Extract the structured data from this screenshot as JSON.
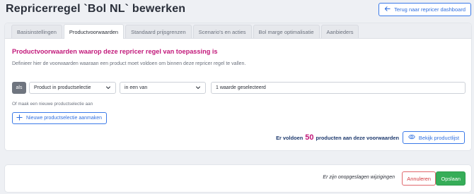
{
  "header": {
    "title": "Repricerregel `Bol NL` bewerken",
    "back_label": "Terug naar repricer dashboard"
  },
  "tabs": [
    {
      "label": "Basisinstellingen",
      "active": false
    },
    {
      "label": "Productvoorwaarden",
      "active": true
    },
    {
      "label": "Standaard prijsgrenzen",
      "active": false
    },
    {
      "label": "Scenario's en acties",
      "active": false
    },
    {
      "label": "Bol marge optimalisatie",
      "active": false
    },
    {
      "label": "Aanbieders",
      "active": false
    }
  ],
  "conditions": {
    "heading": "Productvoorwaarden waarop deze repricer regel van toepassing is",
    "description": "Definieer hier de voorwaarden waaraan een product moet voldoen om binnen deze repricer regel te vallen.",
    "row": {
      "badge": "als",
      "field": "Product in productselectie",
      "operator": "in een van",
      "value": "1 waarde geselecteerd"
    },
    "alt_text": "Of maak een nieuwe productselectie aan",
    "new_selection_label": "Nieuwe productselectie aanmaken",
    "result_prefix": "Er voldoen",
    "result_count": "50",
    "result_suffix": "producten aan deze voorwaarden",
    "view_list_label": "Bekijk productlijst"
  },
  "footer": {
    "unsaved_text": "Er zijn onopgeslagen wijzigingen",
    "cancel_label": "Annuleren",
    "save_label": "Opslaan"
  },
  "colors": {
    "accent": "#2f6fe0",
    "heading": "#c2187a",
    "danger": "#d4393f",
    "success": "#36ad58"
  }
}
